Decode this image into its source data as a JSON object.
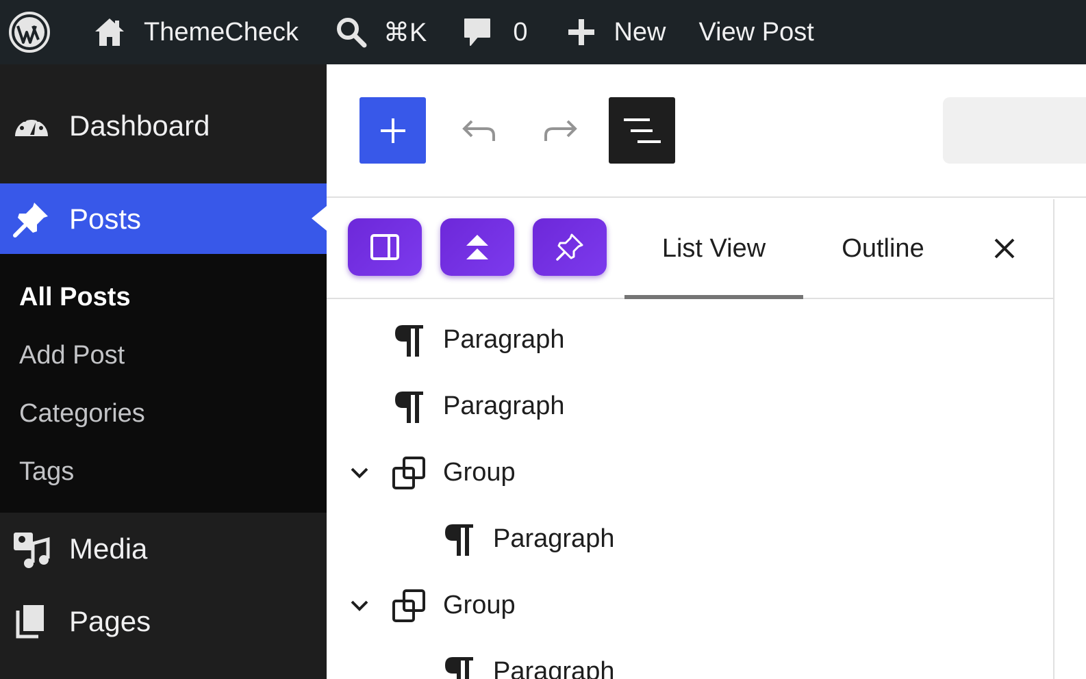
{
  "admin_bar": {
    "site_name": "ThemeCheck",
    "search_shortcut": "⌘K",
    "comments_count": "0",
    "new_label": "New",
    "view_post_label": "View Post"
  },
  "sidebar": {
    "dashboard": "Dashboard",
    "posts": "Posts",
    "submenu": [
      "All Posts",
      "Add Post",
      "Categories",
      "Tags"
    ],
    "media": "Media",
    "pages": "Pages"
  },
  "panel": {
    "tabs": [
      "List View",
      "Outline"
    ],
    "active_tab": "List View",
    "blocks": [
      {
        "label": "Paragraph",
        "icon": "paragraph-icon",
        "level": 1,
        "expandable": false
      },
      {
        "label": "Paragraph",
        "icon": "paragraph-icon",
        "level": 1,
        "expandable": false
      },
      {
        "label": "Group",
        "icon": "group-icon",
        "level": 1,
        "expandable": true
      },
      {
        "label": "Paragraph",
        "icon": "paragraph-icon",
        "level": 2,
        "expandable": false
      },
      {
        "label": "Group",
        "icon": "group-icon",
        "level": 1,
        "expandable": true
      },
      {
        "label": "Paragraph",
        "icon": "paragraph-icon",
        "level": 2,
        "expandable": false
      }
    ]
  },
  "colors": {
    "admin_bar": "#1d2327",
    "sidebar": "#1e1e1e",
    "submenu": "#0c0c0c",
    "accent": "#3858e9",
    "plugin_button": "#7c3aed"
  }
}
